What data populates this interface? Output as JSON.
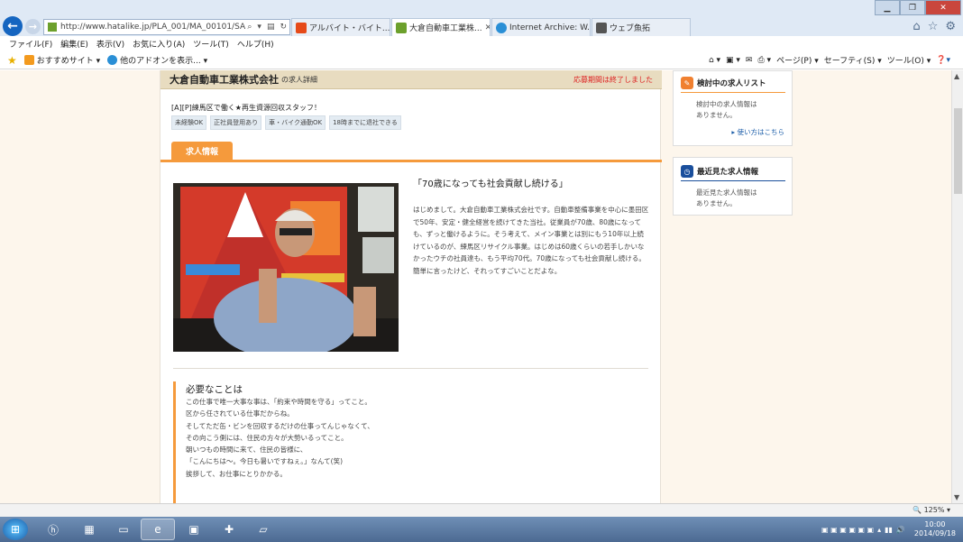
{
  "browser": {
    "url": "http://www.hatalike.jp/PLA_001/MA_00101/SA",
    "tabs": [
      {
        "label": "アルバイト・バイト..."
      },
      {
        "label": "大倉自動車工業株..."
      },
      {
        "label": "Internet Archive: W..."
      },
      {
        "label": "ウェブ魚拓"
      }
    ],
    "menu": [
      "ファイル(F)",
      "編集(E)",
      "表示(V)",
      "お気に入り(A)",
      "ツール(T)",
      "ヘルプ(H)"
    ],
    "favorites": [
      "おすすめサイト ▾",
      "他のアドオンを表示... ▾"
    ],
    "command_bar": [
      "ページ(P) ▾",
      "セーフティ(S) ▾",
      "ツール(O) ▾"
    ],
    "zoom": "125%",
    "accent": "#f59a3c"
  },
  "header": {
    "company": "大倉自動車工業株式会社",
    "subtitle": "の求人詳細",
    "closed_notice": "応募期間は終了しました"
  },
  "job": {
    "title": "[A][P]練馬区で働く★再生資源回収スタッフ！",
    "tags": [
      "未経験OK",
      "正社員登用あり",
      "車・バイク通勤OK",
      "18時までに退社できる"
    ],
    "section_tab": "求人情報"
  },
  "story": {
    "quote": "「70歳になっても社会貢献し続ける」",
    "paragraph": "はじめまして。大倉自動車工業株式会社です。自動車整備事業を中心に墨田区で50年、安定・健全経営を続けてきた当社。従業員が70歳、80歳になっても、ずっと働けるように。そう考えて、メイン事業とは別にもう10年以上続けているのが、練馬区リサイクル事業。はじめは60歳くらいの若手しかいなかったウチの社員達も、もう平均70代。70歳になっても社会貢献し続ける。簡単に言ったけど、それってすごいことだよな。"
  },
  "needs": {
    "heading": "必要なことは",
    "lines": [
      "この仕事で唯一大事な事は、「約束や時間を守る」ってこと。",
      "区から任されている仕事だからね。",
      "",
      "そしてただ缶・ビンを回収するだけの仕事ってんじゃなくて、",
      "その向こう側には、住民の方々が大勢いるってこと。",
      "朝いつもの時間に来て、住民の皆様に、",
      "「こんにちは～。今日も暑いですねぇ。」なんて(笑)",
      "挨拶して、お仕事にとりかかる。"
    ]
  },
  "sidebar": {
    "considering": {
      "title": "検討中の求人リスト",
      "empty": "検討中の求人情報は\nありません。",
      "link": "▸ 使い方はこちら"
    },
    "recent": {
      "title": "最近見た求人情報",
      "empty": "最近見た求人情報は\nありません。"
    }
  },
  "taskbar": {
    "time": "10:00",
    "date": "2014/09/18"
  }
}
